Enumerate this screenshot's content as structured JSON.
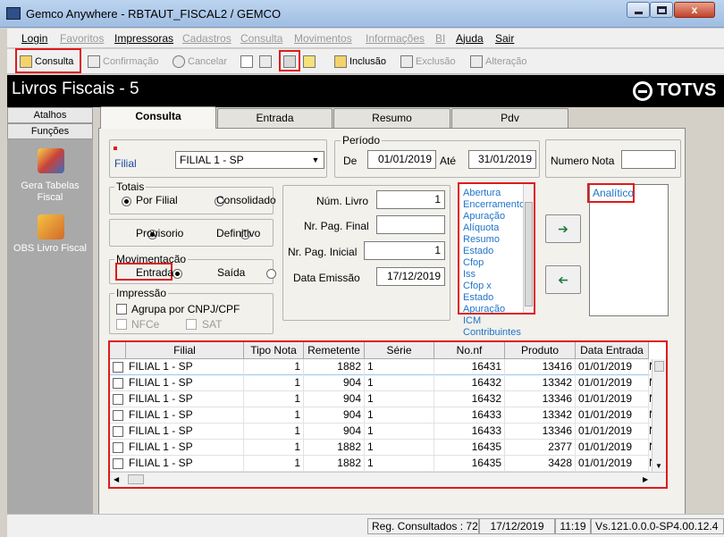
{
  "window": {
    "title": "Gemco Anywhere - RBTAUT_FISCAL2 / GEMCO",
    "close_label": "x"
  },
  "menu": [
    "Login",
    "Favoritos",
    "Impressoras",
    "Cadastros",
    "Consulta",
    "Movimentos",
    "Informações",
    "BI",
    "Ajuda",
    "Sair"
  ],
  "toolbar": {
    "consulta": "Consulta",
    "confirmacao": "Confirmação",
    "cancelar": "Cancelar",
    "inclusao": "Inclusão",
    "exclusao": "Exclusão",
    "alteracao": "Alteração"
  },
  "header": {
    "title": "Livros Fiscais  - 5",
    "logo": "TOTVS"
  },
  "left": {
    "atalhos": "Atalhos",
    "funcoes": "Funções",
    "item1": "Gera Tabelas Fiscal",
    "item2": "OBS Livro Fiscal"
  },
  "tabs": [
    "Consulta",
    "Entrada",
    "Resumo",
    "Pdv"
  ],
  "form": {
    "filial_label": "Filial",
    "filial_value": "FILIAL 1 - SP",
    "periodo_label": "Período",
    "de_label": "De",
    "de_value": "01/01/2019",
    "ate_label": "Até",
    "ate_value": "31/01/2019",
    "numero_nota_label": "Numero Nota",
    "totais_label": "Totais",
    "por_filial": "Por Filial",
    "consolidado": "Consolidado",
    "provisorio": "Provisorio",
    "definitivo": "Definitivo",
    "movimentacao_label": "Movimentação",
    "entrada": "Entrada",
    "saida": "Saída",
    "impressao_label": "Impressão",
    "agrupa": "Agrupa por CNPJ/CPF",
    "nfce": "NFCe",
    "sat": "SAT",
    "num_livro_label": "Núm. Livro",
    "num_livro_value": "1",
    "nr_pag_final_label": "Nr. Pag. Final",
    "nr_pag_inicial_label": "Nr. Pag. Inicial",
    "nr_pag_inicial_value": "1",
    "data_emissao_label": "Data Emissão",
    "data_emissao_value": "17/12/2019"
  },
  "available_list": [
    "Abertura",
    "Encerramento",
    "Apuração",
    "Alíquota",
    "Resumo",
    "Estado",
    "Cfop",
    "Iss",
    "Cfop x Estado",
    "Apuração ICM",
    "Contribuintes"
  ],
  "selected_list": [
    "Analítico"
  ],
  "grid": {
    "columns": [
      "Filial",
      "Tipo Nota",
      "Remetente",
      "Série",
      "No.nf",
      "Produto",
      "Data Entrada"
    ],
    "rows": [
      [
        "FILIAL 1 - SP",
        "1",
        "1882",
        "1",
        "16431",
        "13416",
        "01/01/2019"
      ],
      [
        "FILIAL 1 - SP",
        "1",
        "904",
        "1",
        "16432",
        "13342",
        "01/01/2019"
      ],
      [
        "FILIAL 1 - SP",
        "1",
        "904",
        "1",
        "16432",
        "13346",
        "01/01/2019"
      ],
      [
        "FILIAL 1 - SP",
        "1",
        "904",
        "1",
        "16433",
        "13342",
        "01/01/2019"
      ],
      [
        "FILIAL 1 - SP",
        "1",
        "904",
        "1",
        "16433",
        "13346",
        "01/01/2019"
      ],
      [
        "FILIAL 1 - SP",
        "1",
        "1882",
        "1",
        "16435",
        "2377",
        "01/01/2019"
      ],
      [
        "FILIAL 1 - SP",
        "1",
        "1882",
        "1",
        "16435",
        "3428",
        "01/01/2019"
      ]
    ],
    "overflow_marker": "N"
  },
  "status": {
    "reg": "Reg. Consultados : 72",
    "date": "17/12/2019",
    "time": "11:19",
    "version": "Vs.121.0.0.0-SP4.00.12.4"
  }
}
